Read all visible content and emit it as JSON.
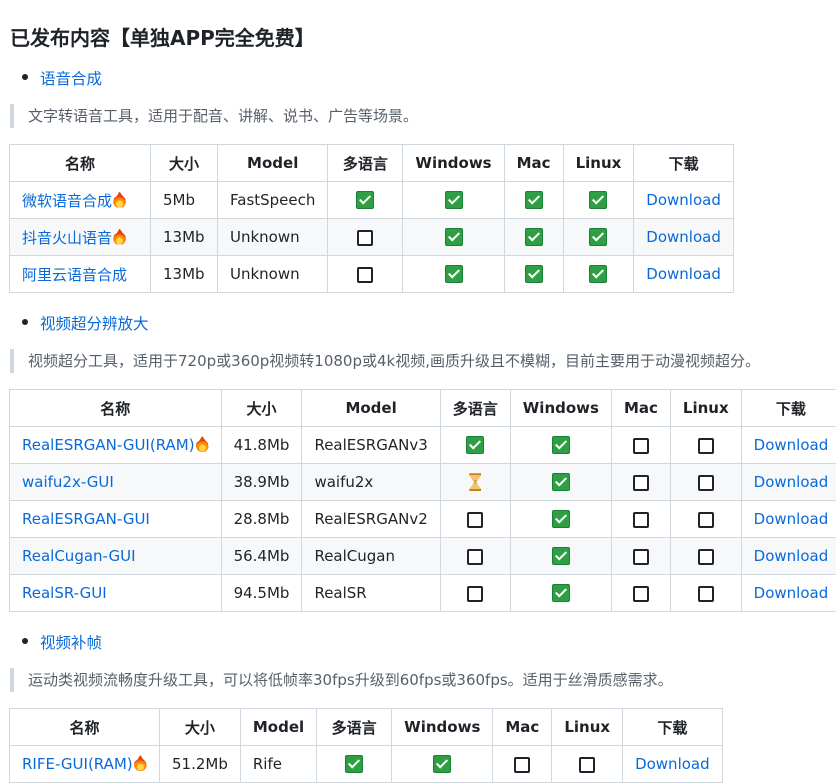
{
  "heading": "已发布内容【单独APP完全免费】",
  "headers": {
    "name": "名称",
    "size": "大小",
    "model": "Model",
    "multilang": "多语言",
    "windows": "Windows",
    "mac": "Mac",
    "linux": "Linux",
    "download": "下载"
  },
  "sections": [
    {
      "title": "语音合成",
      "description": "文字转语音工具，适用于配音、讲解、说书、广告等场景。",
      "rows": [
        {
          "name": "微软语音合成",
          "hot": true,
          "size": "5Mb",
          "model": "FastSpeech",
          "multilang": "yes",
          "windows": "yes",
          "mac": "yes",
          "linux": "yes",
          "download": "Download"
        },
        {
          "name": "抖音火山语音",
          "hot": true,
          "size": "13Mb",
          "model": "Unknown",
          "multilang": "no",
          "windows": "yes",
          "mac": "yes",
          "linux": "yes",
          "download": "Download"
        },
        {
          "name": "阿里云语音合成",
          "hot": false,
          "size": "13Mb",
          "model": "Unknown",
          "multilang": "no",
          "windows": "yes",
          "mac": "yes",
          "linux": "yes",
          "download": "Download"
        }
      ]
    },
    {
      "title": "视频超分辨放大",
      "description": "视频超分工具，适用于720p或360p视频转1080p或4k视频,画质升级且不模糊，目前主要用于动漫视频超分。",
      "rows": [
        {
          "name": "RealESRGAN-GUI(RAM)",
          "hot": true,
          "size": "41.8Mb",
          "model": "RealESRGANv3",
          "multilang": "yes",
          "windows": "yes",
          "mac": "no",
          "linux": "no",
          "download": "Download"
        },
        {
          "name": "waifu2x-GUI",
          "hot": false,
          "size": "38.9Mb",
          "model": "waifu2x",
          "multilang": "pending",
          "windows": "yes",
          "mac": "no",
          "linux": "no",
          "download": "Download"
        },
        {
          "name": "RealESRGAN-GUI",
          "hot": false,
          "size": "28.8Mb",
          "model": "RealESRGANv2",
          "multilang": "no",
          "windows": "yes",
          "mac": "no",
          "linux": "no",
          "download": "Download"
        },
        {
          "name": "RealCugan-GUI",
          "hot": false,
          "size": "56.4Mb",
          "model": "RealCugan",
          "multilang": "no",
          "windows": "yes",
          "mac": "no",
          "linux": "no",
          "download": "Download"
        },
        {
          "name": "RealSR-GUI",
          "hot": false,
          "size": "94.5Mb",
          "model": "RealSR",
          "multilang": "no",
          "windows": "yes",
          "mac": "no",
          "linux": "no",
          "download": "Download"
        }
      ]
    },
    {
      "title": "视频补帧",
      "description": "运动类视频流畅度升级工具，可以将低帧率30fps升级到60fps或360fps。适用于丝滑质感需求。",
      "rows": [
        {
          "name": "RIFE-GUI(RAM)",
          "hot": true,
          "size": "51.2Mb",
          "model": "Rife",
          "multilang": "yes",
          "windows": "yes",
          "mac": "no",
          "linux": "no",
          "download": "Download"
        }
      ]
    }
  ],
  "icons": {
    "yes": "check-mark-button-icon",
    "no": "empty-checkbox-icon",
    "pending": "hourglass-icon",
    "hot": "fire-icon"
  },
  "colors": {
    "link": "#0969da",
    "check_green": "#2ea043",
    "border": "#d0d7de",
    "stripe": "#f6f8fa"
  }
}
